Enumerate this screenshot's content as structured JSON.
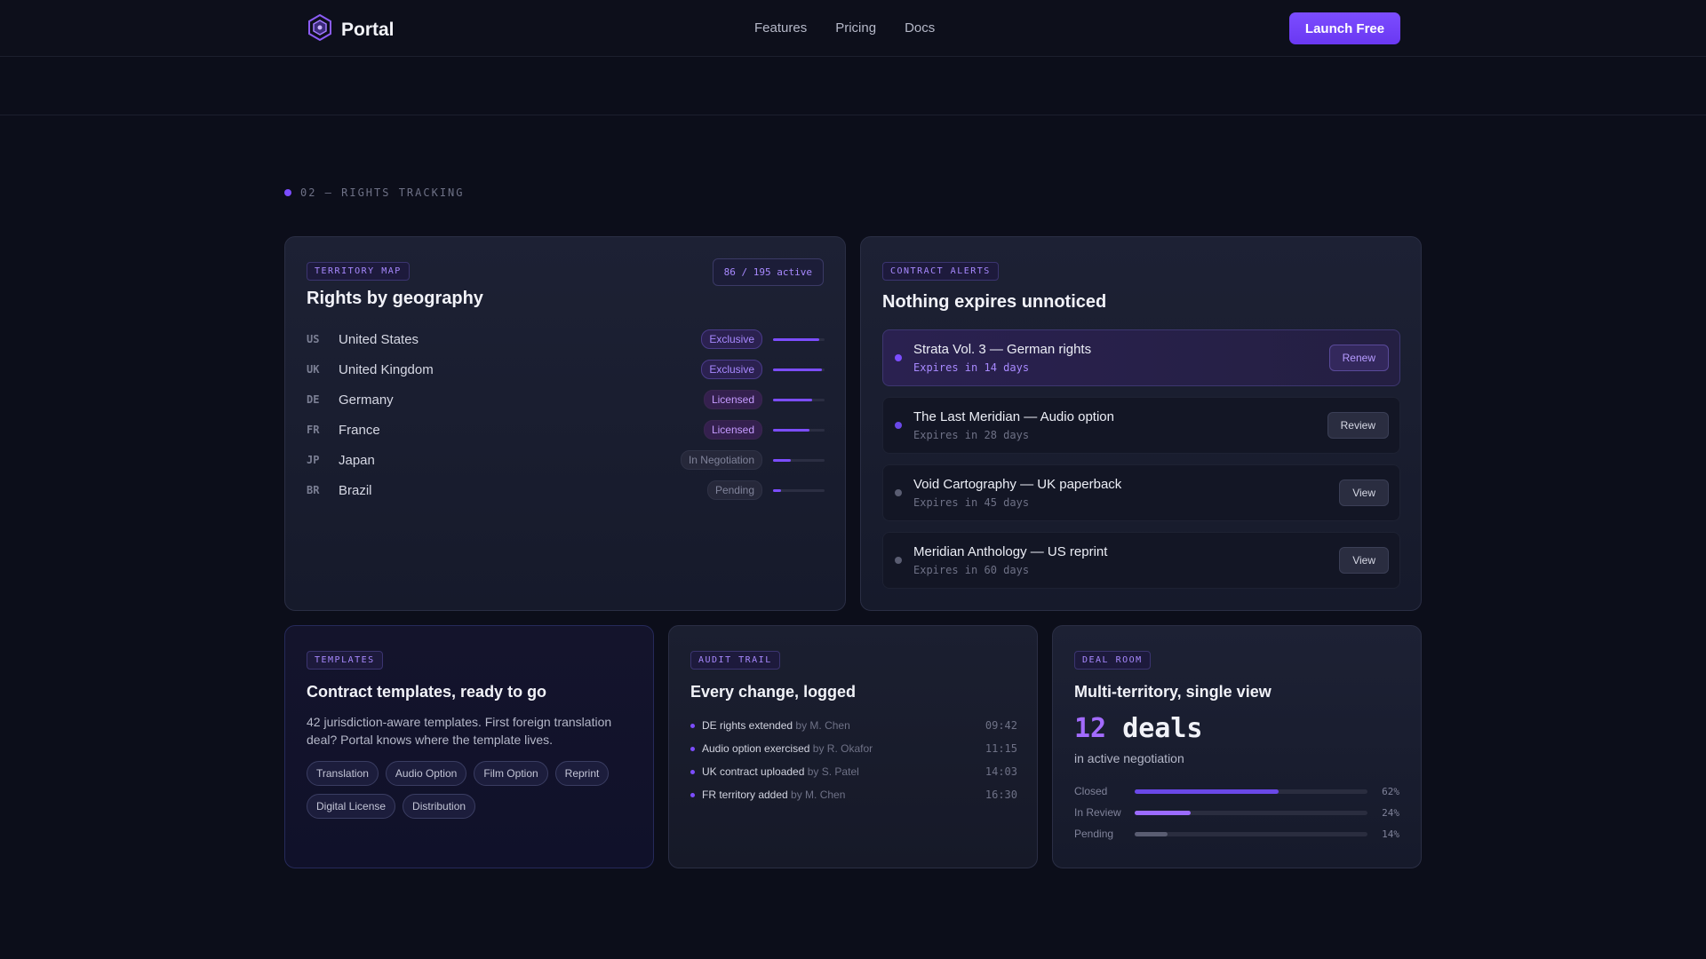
{
  "nav": {
    "brand": "Portal",
    "links": [
      "Features",
      "Pricing",
      "Docs"
    ],
    "cta": "Launch Free"
  },
  "section": {
    "label": "02 — RIGHTS TRACKING"
  },
  "territory": {
    "tag": "TERRITORY MAP",
    "title": "Rights by geography",
    "active_badge": "86 / 195 active",
    "rows": [
      {
        "code": "US",
        "name": "United States",
        "status": "Exclusive",
        "progress": 0.9
      },
      {
        "code": "UK",
        "name": "United Kingdom",
        "status": "Exclusive",
        "progress": 0.95
      },
      {
        "code": "DE",
        "name": "Germany",
        "status": "Licensed",
        "progress": 0.75
      },
      {
        "code": "FR",
        "name": "France",
        "status": "Licensed",
        "progress": 0.7
      },
      {
        "code": "JP",
        "name": "Japan",
        "status": "In Negotiation",
        "progress": 0.35
      },
      {
        "code": "BR",
        "name": "Brazil",
        "status": "Pending",
        "progress": 0.15
      }
    ]
  },
  "alerts": {
    "tag": "CONTRACT ALERTS",
    "title": "Nothing expires unnoticed",
    "items": [
      {
        "title": "Strata Vol. 3 — German rights",
        "sub": "Expires in 14 days",
        "button": "Renew",
        "dot_color": "#7c4dff"
      },
      {
        "title": "The Last Meridian — Audio option",
        "sub": "Expires in 28 days",
        "button": "Review",
        "dot_color": "#6a48e8"
      },
      {
        "title": "Void Cartography — UK paperback",
        "sub": "Expires in 45 days",
        "button": "View",
        "dot_color": "#5a5d72"
      },
      {
        "title": "Meridian Anthology — US reprint",
        "sub": "Expires in 60 days",
        "button": "View",
        "dot_color": "#5a5d72"
      }
    ]
  },
  "templates": {
    "tag": "TEMPLATES",
    "title": "Contract templates, ready to go",
    "description": "42 jurisdiction-aware templates. First foreign translation deal? Portal knows where the template lives.",
    "chips": [
      "Translation",
      "Audio Option",
      "Film Option",
      "Reprint",
      "Digital License",
      "Distribution"
    ]
  },
  "audit": {
    "tag": "AUDIT TRAIL",
    "title": "Every change, logged",
    "items": [
      {
        "text": "DE rights extended",
        "by": "by M. Chen",
        "time": "09:42"
      },
      {
        "text": "Audio option exercised",
        "by": "by R. Okafor",
        "time": "11:15"
      },
      {
        "text": "UK contract uploaded",
        "by": "by S. Patel",
        "time": "14:03"
      },
      {
        "text": "FR territory added",
        "by": "by M. Chen",
        "time": "16:30"
      }
    ]
  },
  "deal": {
    "tag": "DEAL ROOM",
    "title": "Multi-territory, single view",
    "count": "12",
    "count_word": "deals",
    "subtitle": "in active negotiation",
    "rows": [
      {
        "label": "Closed",
        "pct": "62%",
        "value": 0.62,
        "color": "#6a48e8"
      },
      {
        "label": "In Review",
        "pct": "24%",
        "value": 0.24,
        "color": "#9b6bff"
      },
      {
        "label": "Pending",
        "pct": "14%",
        "value": 0.14,
        "color": "#5a5d72"
      }
    ]
  }
}
